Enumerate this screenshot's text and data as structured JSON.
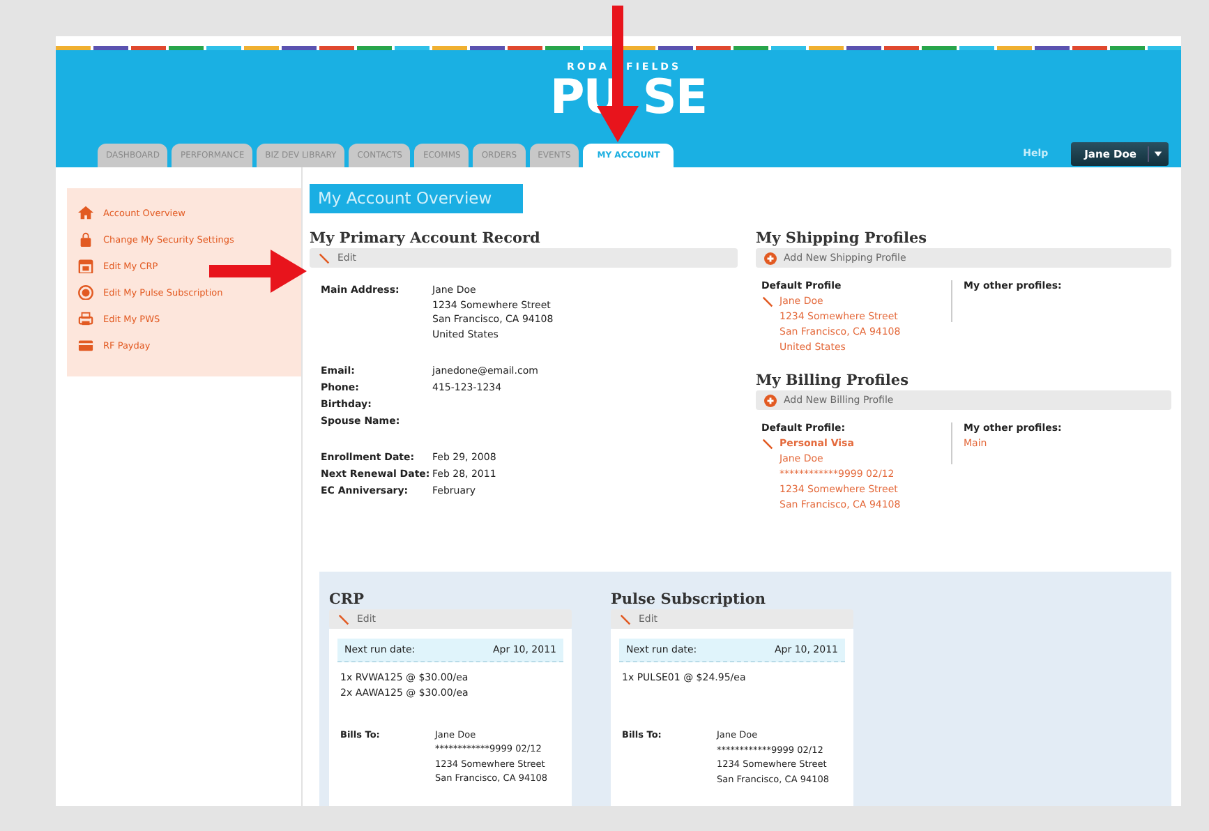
{
  "header": {
    "logo": {
      "brand": [
        "RODA",
        "FIELDS"
      ],
      "product": [
        "PU",
        "SE"
      ]
    },
    "tabs": [
      {
        "label": "DASHBOARD",
        "selected": false
      },
      {
        "label": "PERFORMANCE",
        "selected": false
      },
      {
        "label": "BIZ DEV LIBRARY",
        "selected": false
      },
      {
        "label": "CONTACTS",
        "selected": false
      },
      {
        "label": "ECOMMS",
        "selected": false
      },
      {
        "label": "ORDERS",
        "selected": false
      },
      {
        "label": "EVENTS",
        "selected": false
      },
      {
        "label": "MY ACCOUNT",
        "selected": true
      }
    ],
    "help_link": "Help",
    "user_menu": {
      "label": "Jane Doe"
    }
  },
  "sidebar": {
    "items": [
      {
        "label": "Account Overview"
      },
      {
        "label": "Change My Security Settings"
      },
      {
        "label": "Edit My CRP"
      },
      {
        "label": "Edit My Pulse Subscription"
      },
      {
        "label": "Edit My PWS"
      },
      {
        "label": "RF Payday"
      }
    ]
  },
  "page_title": "My Account Overview",
  "primary_record": {
    "title": "My Primary Account Record",
    "edit_label": "Edit",
    "groups": [
      [
        {
          "label": "Main Address:",
          "lines": [
            "Jane Doe",
            "1234 Somewhere Street",
            "San Francisco, CA 94108",
            "United States"
          ]
        }
      ],
      [
        {
          "label": "Email:",
          "lines": [
            "janedone@email.com"
          ]
        },
        {
          "label": "Phone:",
          "lines": [
            "415-123-1234"
          ]
        },
        {
          "label": "Birthday:"
        },
        {
          "label": "Spouse Name:"
        }
      ],
      [
        {
          "label": "Enrollment Date:",
          "lines": [
            "Feb 29, 2008"
          ]
        },
        {
          "label": "Next Renewal Date:",
          "lines": [
            "Feb 28, 2011"
          ]
        },
        {
          "label": "EC Anniversary:",
          "lines": [
            "February"
          ]
        }
      ]
    ]
  },
  "shipping_profiles": {
    "title": "My Shipping Profiles",
    "add_label": "Add New Shipping Profile",
    "default_heading": "Default Profile",
    "default_lines": [
      "Jane Doe",
      "1234 Somewhere Street",
      "San Francisco, CA 94108",
      "United States"
    ],
    "other_heading": "My other profiles:"
  },
  "billing_profiles": {
    "title": "My Billing Profiles",
    "add_label": "Add New Billing Profile",
    "default_heading": "Default Profile:",
    "default_name": "Personal Visa",
    "default_lines": [
      "Jane Doe",
      "************9999 02/12",
      "1234 Somewhere Street",
      "San Francisco, CA 94108"
    ],
    "other_heading": "My other profiles:",
    "other_items": [
      "Main"
    ]
  },
  "subscriptions": [
    {
      "title": "CRP",
      "edit_label": "Edit",
      "next_run_label": "Next run date:",
      "next_run_date": "Apr 10, 2011",
      "items": [
        "1x RVWA125 @ $30.00/ea",
        "2x AAWA125 @ $30.00/ea"
      ],
      "bills_to_label": "Bills To:",
      "bills_to_lines": [
        "Jane Doe",
        "************9999 02/12",
        "1234 Somewhere Street",
        "San Francisco, CA 94108"
      ]
    },
    {
      "title": "Pulse Subscription",
      "edit_label": "Edit",
      "next_run_label": "Next run date:",
      "next_run_date": "Apr 10, 2011",
      "items": [
        "1x PULSE01 @ $24.95/ea"
      ],
      "bills_to_label": "Bills To:",
      "bills_to_lines": [
        "Jane Doe",
        "************9999 02/12",
        "1234 Somewhere Street",
        "San Francisco, CA 94108"
      ]
    }
  ]
}
